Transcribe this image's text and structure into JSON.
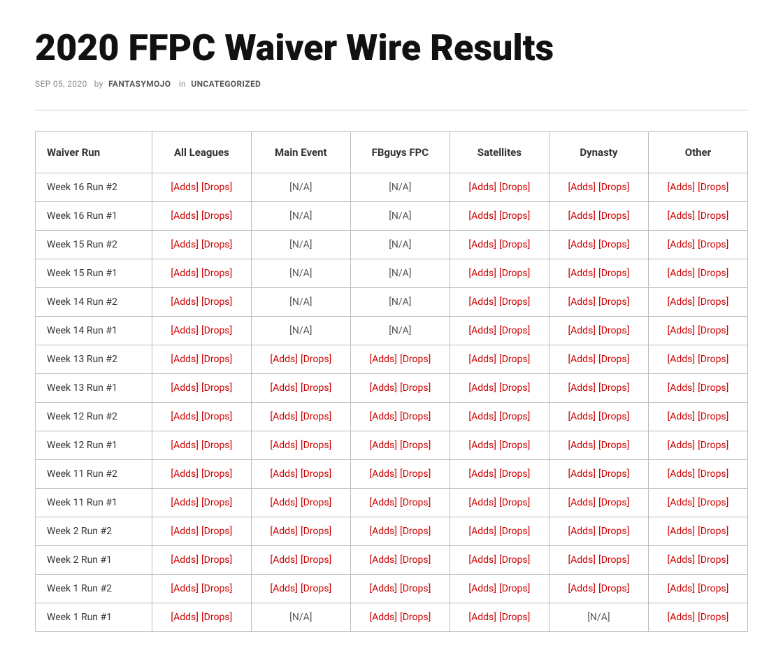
{
  "page": {
    "title": "2020 FFPC Waiver Wire Results",
    "meta": {
      "date": "SEP 05, 2020",
      "by_label": "by",
      "author": "FANTASYMOJO",
      "in_label": "in",
      "category": "UNCATEGORIZED"
    }
  },
  "table": {
    "headers": [
      "Waiver Run",
      "All Leagues",
      "Main Event",
      "FBguys FPC",
      "Satellites",
      "Dynasty",
      "Other"
    ],
    "rows": [
      {
        "week": "Week 16 Run #2",
        "all_leagues": {
          "adds": "[Adds]",
          "drops": "[Drops]",
          "type": "links"
        },
        "main_event": {
          "value": "[N/A]",
          "type": "na"
        },
        "fbguys": {
          "value": "[N/A]",
          "type": "na"
        },
        "satellites": {
          "adds": "[Adds]",
          "drops": "[Drops]",
          "type": "links"
        },
        "dynasty": {
          "adds": "[Adds]",
          "drops": "[Drops]",
          "type": "links"
        },
        "other": {
          "adds": "[Adds]",
          "drops": "[Drops]",
          "type": "links"
        }
      },
      {
        "week": "Week 16 Run #1",
        "all_leagues": {
          "adds": "[Adds]",
          "drops": "[Drops]",
          "type": "links"
        },
        "main_event": {
          "value": "[N/A]",
          "type": "na"
        },
        "fbguys": {
          "value": "[N/A]",
          "type": "na"
        },
        "satellites": {
          "adds": "[Adds]",
          "drops": "[Drops]",
          "type": "links"
        },
        "dynasty": {
          "adds": "[Adds]",
          "drops": "[Drops]",
          "type": "links"
        },
        "other": {
          "adds": "[Adds]",
          "drops": "[Drops]",
          "type": "links"
        }
      },
      {
        "week": "Week 15 Run #2",
        "all_leagues": {
          "adds": "[Adds]",
          "drops": "[Drops]",
          "type": "links"
        },
        "main_event": {
          "value": "[N/A]",
          "type": "na"
        },
        "fbguys": {
          "value": "[N/A]",
          "type": "na"
        },
        "satellites": {
          "adds": "[Adds]",
          "drops": "[Drops]",
          "type": "links"
        },
        "dynasty": {
          "adds": "[Adds]",
          "drops": "[Drops]",
          "type": "links"
        },
        "other": {
          "adds": "[Adds]",
          "drops": "[Drops]",
          "type": "links"
        }
      },
      {
        "week": "Week 15 Run #1",
        "all_leagues": {
          "adds": "[Adds]",
          "drops": "[Drops]",
          "type": "links"
        },
        "main_event": {
          "value": "[N/A]",
          "type": "na"
        },
        "fbguys": {
          "value": "[N/A]",
          "type": "na"
        },
        "satellites": {
          "adds": "[Adds]",
          "drops": "[Drops]",
          "type": "links"
        },
        "dynasty": {
          "adds": "[Adds]",
          "drops": "[Drops]",
          "type": "links"
        },
        "other": {
          "adds": "[Adds]",
          "drops": "[Drops]",
          "type": "links"
        }
      },
      {
        "week": "Week 14 Run #2",
        "all_leagues": {
          "adds": "[Adds]",
          "drops": "[Drops]",
          "type": "links"
        },
        "main_event": {
          "value": "[N/A]",
          "type": "na"
        },
        "fbguys": {
          "value": "[N/A]",
          "type": "na"
        },
        "satellites": {
          "adds": "[Adds]",
          "drops": "[Drops]",
          "type": "links"
        },
        "dynasty": {
          "adds": "[Adds]",
          "drops": "[Drops]",
          "type": "links"
        },
        "other": {
          "adds": "[Adds]",
          "drops": "[Drops]",
          "type": "links"
        }
      },
      {
        "week": "Week 14 Run #1",
        "all_leagues": {
          "adds": "[Adds]",
          "drops": "[Drops]",
          "type": "links"
        },
        "main_event": {
          "value": "[N/A]",
          "type": "na"
        },
        "fbguys": {
          "value": "[N/A]",
          "type": "na"
        },
        "satellites": {
          "adds": "[Adds]",
          "drops": "[Drops]",
          "type": "links"
        },
        "dynasty": {
          "adds": "[Adds]",
          "drops": "[Drops]",
          "type": "links"
        },
        "other": {
          "adds": "[Adds]",
          "drops": "[Drops]",
          "type": "links"
        }
      },
      {
        "week": "Week 13 Run #2",
        "all_leagues": {
          "adds": "[Adds]",
          "drops": "[Drops]",
          "type": "links"
        },
        "main_event": {
          "adds": "[Adds]",
          "drops": "[Drops]",
          "type": "links"
        },
        "fbguys": {
          "adds": "[Adds]",
          "drops": "[Drops]",
          "type": "links"
        },
        "satellites": {
          "adds": "[Adds]",
          "drops": "[Drops]",
          "type": "links"
        },
        "dynasty": {
          "adds": "[Adds]",
          "drops": "[Drops]",
          "type": "links"
        },
        "other": {
          "adds": "[Adds]",
          "drops": "[Drops]",
          "type": "links"
        }
      },
      {
        "week": "Week 13 Run #1",
        "all_leagues": {
          "adds": "[Adds]",
          "drops": "[Drops]",
          "type": "links"
        },
        "main_event": {
          "adds": "[Adds]",
          "drops": "[Drops]",
          "type": "links"
        },
        "fbguys": {
          "adds": "[Adds]",
          "drops": "[Drops]",
          "type": "links"
        },
        "satellites": {
          "adds": "[Adds]",
          "drops": "[Drops]",
          "type": "links"
        },
        "dynasty": {
          "adds": "[Adds]",
          "drops": "[Drops]",
          "type": "links"
        },
        "other": {
          "adds": "[Adds]",
          "drops": "[Drops]",
          "type": "links"
        }
      },
      {
        "week": "Week 12 Run #2",
        "all_leagues": {
          "adds": "[Adds]",
          "drops": "[Drops]",
          "type": "links"
        },
        "main_event": {
          "adds": "[Adds]",
          "drops": "[Drops]",
          "type": "links"
        },
        "fbguys": {
          "adds": "[Adds]",
          "drops": "[Drops]",
          "type": "links"
        },
        "satellites": {
          "adds": "[Adds]",
          "drops": "[Drops]",
          "type": "links"
        },
        "dynasty": {
          "adds": "[Adds]",
          "drops": "[Drops]",
          "type": "links"
        },
        "other": {
          "adds": "[Adds]",
          "drops": "[Drops]",
          "type": "links"
        }
      },
      {
        "week": "Week 12 Run #1",
        "all_leagues": {
          "adds": "[Adds]",
          "drops": "[Drops]",
          "type": "links"
        },
        "main_event": {
          "adds": "[Adds]",
          "drops": "[Drops]",
          "type": "links"
        },
        "fbguys": {
          "adds": "[Adds]",
          "drops": "[Drops]",
          "type": "links"
        },
        "satellites": {
          "adds": "[Adds]",
          "drops": "[Drops]",
          "type": "links"
        },
        "dynasty": {
          "adds": "[Adds]",
          "drops": "[Drops]",
          "type": "links"
        },
        "other": {
          "adds": "[Adds]",
          "drops": "[Drops]",
          "type": "links"
        }
      },
      {
        "week": "Week 11 Run #2",
        "all_leagues": {
          "adds": "[Adds]",
          "drops": "[Drops]",
          "type": "links"
        },
        "main_event": {
          "adds": "[Adds]",
          "drops": "[Drops]",
          "type": "links"
        },
        "fbguys": {
          "adds": "[Adds]",
          "drops": "[Drops]",
          "type": "links"
        },
        "satellites": {
          "adds": "[Adds]",
          "drops": "[Drops]",
          "type": "links"
        },
        "dynasty": {
          "adds": "[Adds]",
          "drops": "[Drops]",
          "type": "links"
        },
        "other": {
          "adds": "[Adds]",
          "drops": "[Drops]",
          "type": "links"
        }
      },
      {
        "week": "Week 11 Run #1",
        "all_leagues": {
          "adds": "[Adds]",
          "drops": "[Drops]",
          "type": "links"
        },
        "main_event": {
          "adds": "[Adds]",
          "drops": "[Drops]",
          "type": "links"
        },
        "fbguys": {
          "adds": "[Adds]",
          "drops": "[Drops]",
          "type": "links"
        },
        "satellites": {
          "adds": "[Adds]",
          "drops": "[Drops]",
          "type": "links"
        },
        "dynasty": {
          "adds": "[Adds]",
          "drops": "[Drops]",
          "type": "links"
        },
        "other": {
          "adds": "[Adds]",
          "drops": "[Drops]",
          "type": "links"
        }
      },
      {
        "week": "Week 2 Run #2",
        "all_leagues": {
          "adds": "[Adds]",
          "drops": "[Drops]",
          "type": "links"
        },
        "main_event": {
          "adds": "[Adds]",
          "drops": "[Drops]",
          "type": "links"
        },
        "fbguys": {
          "adds": "[Adds]",
          "drops": "[Drops]",
          "type": "links"
        },
        "satellites": {
          "adds": "[Adds]",
          "drops": "[Drops]",
          "type": "links"
        },
        "dynasty": {
          "adds": "[Adds]",
          "drops": "[Drops]",
          "type": "links"
        },
        "other": {
          "adds": "[Adds]",
          "drops": "[Drops]",
          "type": "links"
        }
      },
      {
        "week": "Week 2 Run #1",
        "all_leagues": {
          "adds": "[Adds]",
          "drops": "[Drops]",
          "type": "links"
        },
        "main_event": {
          "adds": "[Adds]",
          "drops": "[Drops]",
          "type": "links"
        },
        "fbguys": {
          "adds": "[Adds]",
          "drops": "[Drops]",
          "type": "links"
        },
        "satellites": {
          "adds": "[Adds]",
          "drops": "[Drops]",
          "type": "links"
        },
        "dynasty": {
          "adds": "[Adds]",
          "drops": "[Drops]",
          "type": "links"
        },
        "other": {
          "adds": "[Adds]",
          "drops": "[Drops]",
          "type": "links"
        }
      },
      {
        "week": "Week 1 Run #2",
        "all_leagues": {
          "adds": "[Adds]",
          "drops": "[Drops]",
          "type": "links"
        },
        "main_event": {
          "adds": "[Adds]",
          "drops": "[Drops]",
          "type": "links"
        },
        "fbguys": {
          "adds": "[Adds]",
          "drops": "[Drops]",
          "type": "links"
        },
        "satellites": {
          "adds": "[Adds]",
          "drops": "[Drops]",
          "type": "links"
        },
        "dynasty": {
          "adds": "[Adds]",
          "drops": "[Drops]",
          "type": "links"
        },
        "other": {
          "adds": "[Adds]",
          "drops": "[Drops]",
          "type": "links"
        }
      },
      {
        "week": "Week 1 Run #1",
        "all_leagues": {
          "adds": "[Adds]",
          "drops": "[Drops]",
          "type": "links"
        },
        "main_event": {
          "value": "[N/A]",
          "type": "na"
        },
        "fbguys": {
          "adds": "[Adds]",
          "drops": "[Drops]",
          "type": "links"
        },
        "satellites": {
          "adds": "[Adds]",
          "drops": "[Drops]",
          "type": "links"
        },
        "dynasty": {
          "value": "[N/A]",
          "type": "na"
        },
        "other": {
          "adds": "[Adds]",
          "drops": "[Drops]",
          "type": "links"
        }
      }
    ]
  }
}
